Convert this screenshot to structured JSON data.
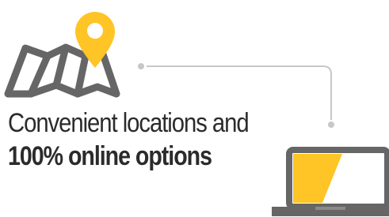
{
  "headline": {
    "line1": "Convenient locations and",
    "line2": "100% online options"
  },
  "icons": {
    "map": "folded-map-icon",
    "pin": "location-pin-icon",
    "laptop": "laptop-icon",
    "connector": "dotted-connector-line"
  },
  "colors": {
    "accent": "#FFC425",
    "outline": "#666666",
    "connector": "#c7c7c7",
    "text": "#2b2b2b",
    "background": "#ffffff"
  }
}
